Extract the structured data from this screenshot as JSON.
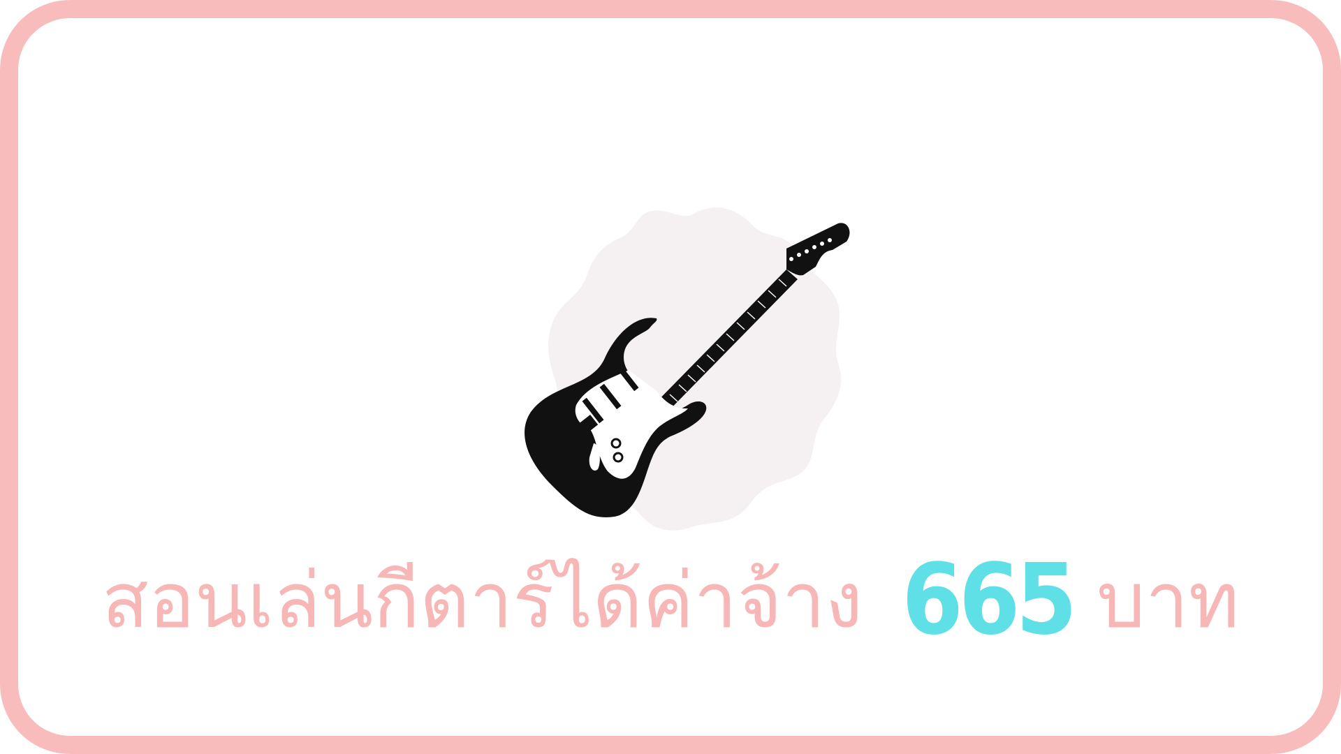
{
  "colors": {
    "frame": "#f9bcbd",
    "text_pink": "#f7b7b7",
    "amount_cyan": "#5ee0e6",
    "blob": "#f5f1f2",
    "guitar": "#111111"
  },
  "illustration": {
    "icon": "electric-guitar-icon",
    "background_shape": "scalloped-blob"
  },
  "headline": {
    "text": "สอนเล่นกีตาร์ได้ค่าจ้าง",
    "amount": "665",
    "unit": "บาท"
  }
}
